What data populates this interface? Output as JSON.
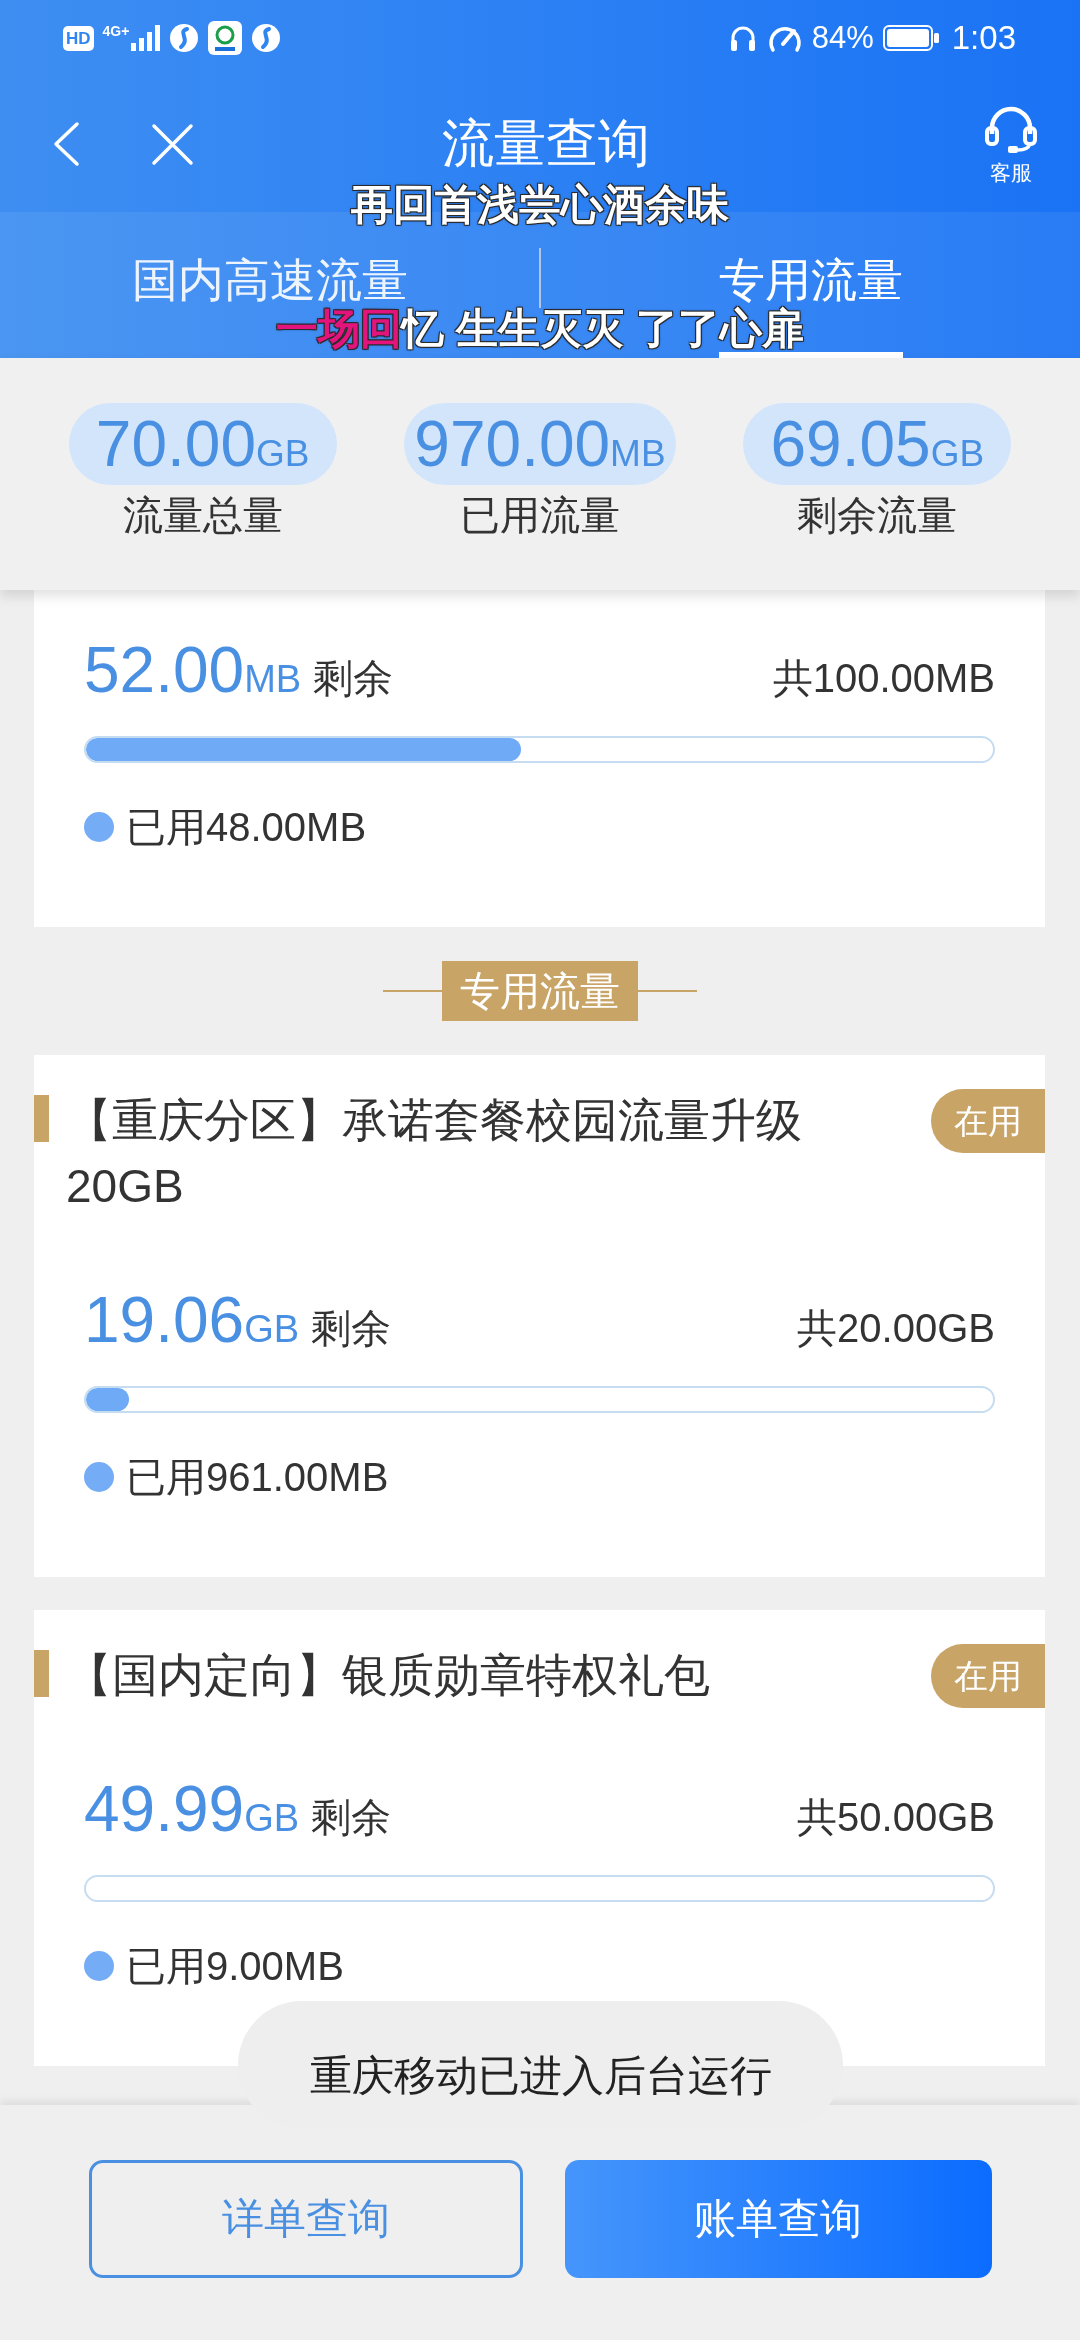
{
  "status_bar": {
    "hd": "HD",
    "network": "4G+",
    "battery": "84%",
    "time": "1:03"
  },
  "header": {
    "title": "流量查询",
    "service_label": "客服"
  },
  "tabs": [
    {
      "label": "国内高速流量",
      "selected": false
    },
    {
      "label": "专用流量",
      "selected": true
    }
  ],
  "lyrics": [
    {
      "unsung": "再回首浅尝心酒余味"
    },
    {
      "sung": "一场回",
      "unsung": "忆 生生灭灭 了了心扉"
    }
  ],
  "summary": [
    {
      "value": "70.00",
      "unit": "GB",
      "label": "流量总量"
    },
    {
      "value": "970.00",
      "unit": "MB",
      "label": "已用流量"
    },
    {
      "value": "69.05",
      "unit": "GB",
      "label": "剩余流量"
    }
  ],
  "sections": [
    {
      "packages": [
        {
          "remaining": "52.00",
          "unit": "MB",
          "remaining_label": "剩余",
          "total": "共100.00MB",
          "level": 0.48,
          "used": "已用48.00MB"
        }
      ]
    },
    {
      "heading": "专用流量",
      "packages": [
        {
          "title": "【重庆分区】承诺套餐校园流量升级20GB",
          "status": "在用",
          "remaining": "19.06",
          "unit": "GB",
          "remaining_label": "剩余",
          "total": "共20.00GB",
          "level": 0.047,
          "used": "已用961.00MB"
        },
        {
          "title": "【国内定向】银质勋章特权礼包",
          "status": "在用",
          "remaining": "49.99",
          "unit": "GB",
          "remaining_label": "剩余",
          "total": "共50.00GB",
          "used": "已用9.00MB"
        }
      ]
    }
  ],
  "toast": "重庆移动已进入后台运行",
  "buttons": [
    {
      "label": "详单查询",
      "kind": "outline"
    },
    {
      "label": "账单查询",
      "kind": "primary"
    }
  ]
}
